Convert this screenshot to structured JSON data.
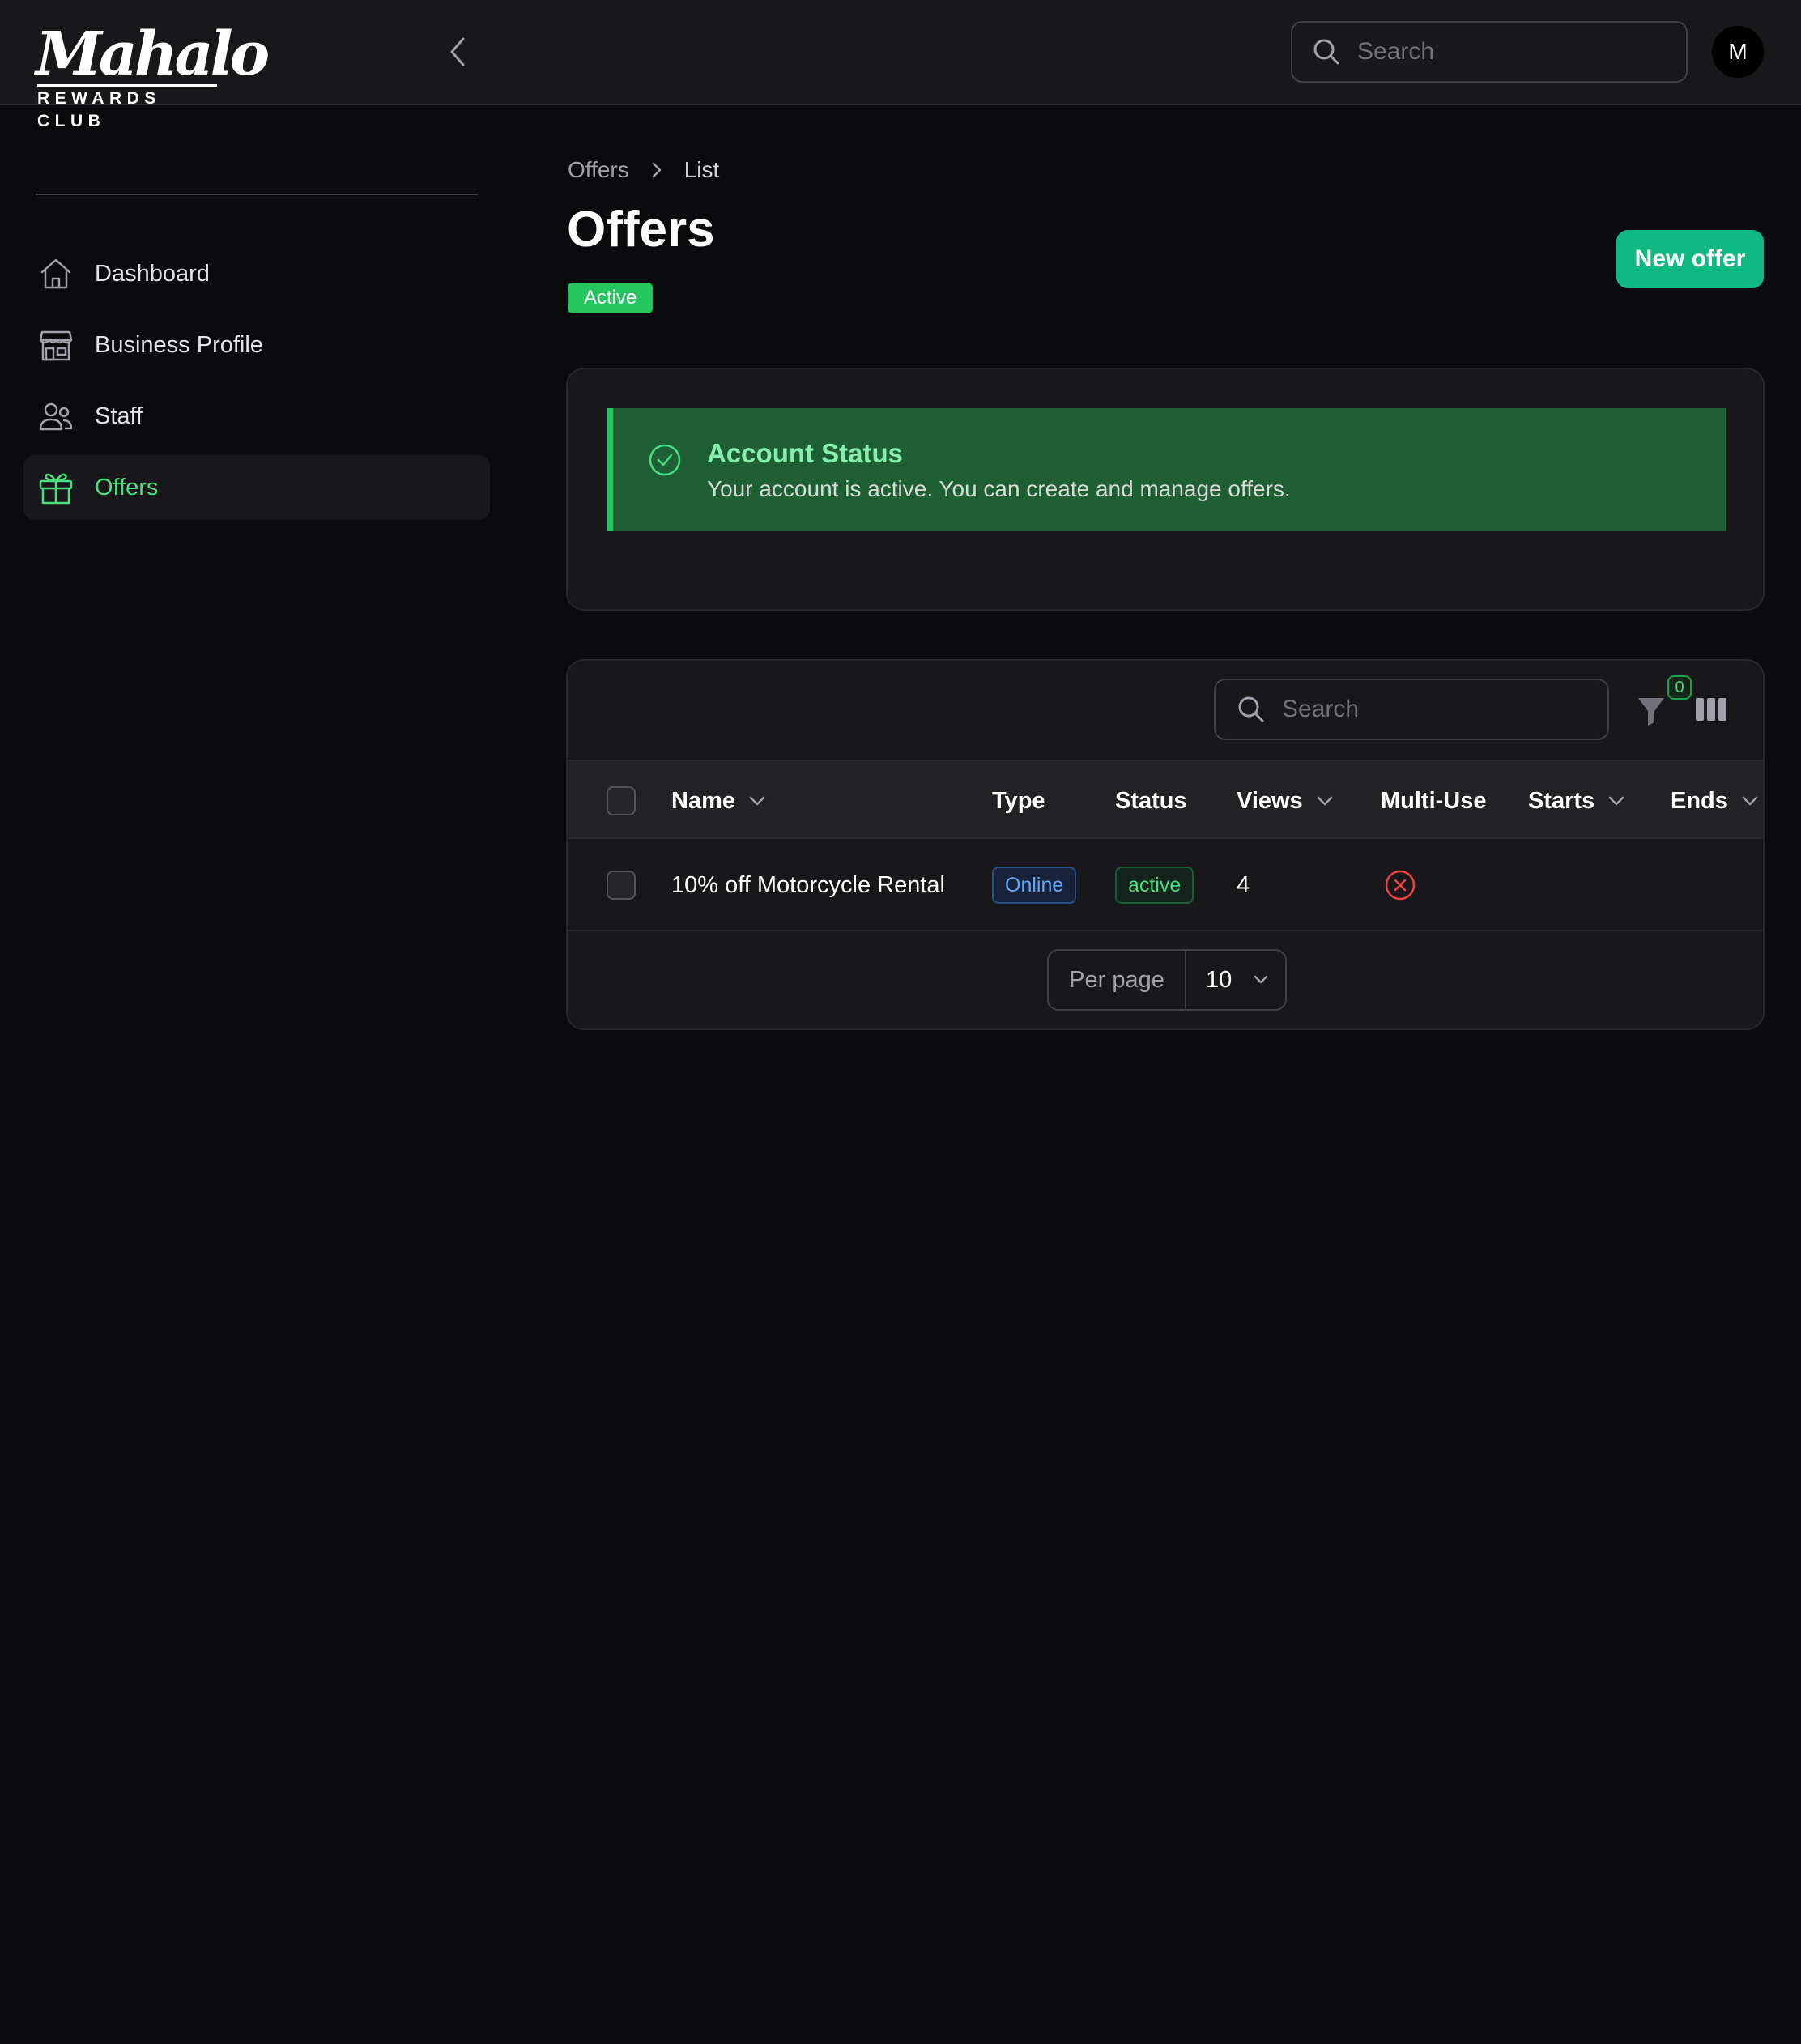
{
  "brand": {
    "name": "Mahalo",
    "tagline": "REWARDS CLUB"
  },
  "topbar": {
    "search_placeholder": "Search",
    "avatar_initial": "M"
  },
  "sidebar": {
    "items": [
      {
        "label": "Dashboard",
        "icon": "home-icon"
      },
      {
        "label": "Business Profile",
        "icon": "storefront-icon"
      },
      {
        "label": "Staff",
        "icon": "users-icon"
      },
      {
        "label": "Offers",
        "icon": "gift-icon",
        "active": true
      }
    ]
  },
  "breadcrumb": [
    "Offers",
    "List"
  ],
  "page": {
    "title": "Offers",
    "status": "Active",
    "new_button": "New offer"
  },
  "alert": {
    "title": "Account Status",
    "message": "Your account is active. You can create and manage offers."
  },
  "table": {
    "search_placeholder": "Search",
    "filter_count": "0",
    "columns": [
      "Name",
      "Type",
      "Status",
      "Views",
      "Multi-Use",
      "Starts",
      "Ends"
    ],
    "rows": [
      {
        "name": "10% off Motorcycle Rental",
        "type": "Online",
        "status": "active",
        "views": "4",
        "multi_use": false,
        "starts": "",
        "ends": ""
      }
    ],
    "per_page_label": "Per page",
    "per_page_value": "10"
  },
  "colors": {
    "accent": "#4ade80",
    "primary_button": "#10b981",
    "active_badge": "#22c55e",
    "alert_background": "#1f5f34",
    "multi_use_false": "#ef4444",
    "online_badge": "#60a5fa"
  }
}
